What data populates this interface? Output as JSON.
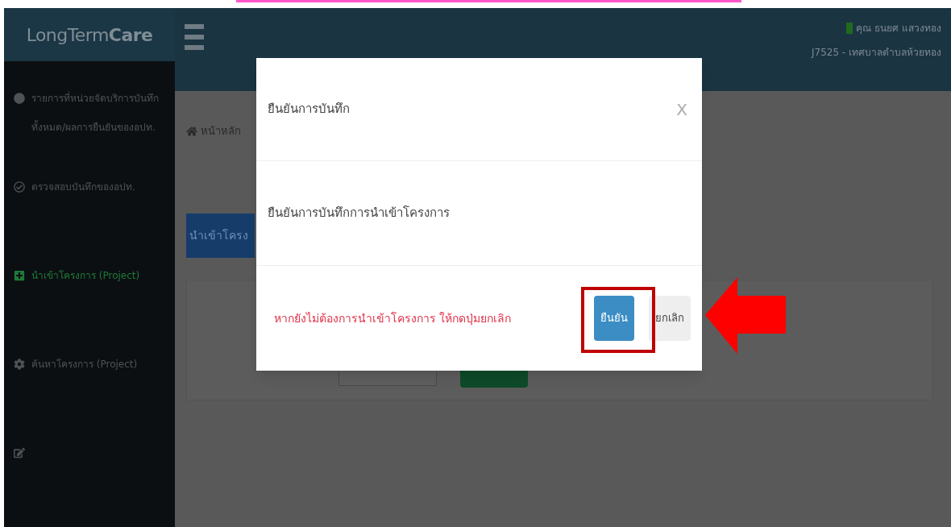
{
  "header": {
    "logo_parts": [
      "LongTerm",
      "Care"
    ],
    "user_name": "คุณ ธนยศ แสวงทอง",
    "user_online": true,
    "user_org": "J7525 - เทศบาลตำบลห้วยทอง"
  },
  "sidebar": {
    "items": [
      {
        "kind": "circle",
        "label": "รายการที่หน่วยจัดบริการบันทึกทั้งหมด/ผลการยืนยันของอปท.",
        "selected": false
      },
      {
        "kind": "check",
        "label": "ตรวจสอบบันทึกของอปท.",
        "selected": false
      },
      {
        "kind": "plus",
        "label": "นำเข้าโครงการ (Project)",
        "selected": true
      },
      {
        "kind": "gear",
        "label": "ค้นหาโครงการ (Project)",
        "selected": false
      },
      {
        "kind": "edit",
        "selected": false
      }
    ]
  },
  "breadcrumb": {
    "home": "หน้าหลัก"
  },
  "page_title": "นำเข้าโครง",
  "modal": {
    "title": "ยืนยันการบันทึก",
    "close": "X",
    "body": "ยืนยันการบันทึกการนำเข้าโครงการ",
    "warning": "หากยังไม่ต้องการนำเข้าโครงการ ให้กดปุ่มยกเลิก",
    "buttons": [
      {
        "kind": "primary",
        "label": "ยืนยัน"
      },
      {
        "kind": "default",
        "label": "ยกเลิก"
      }
    ]
  }
}
